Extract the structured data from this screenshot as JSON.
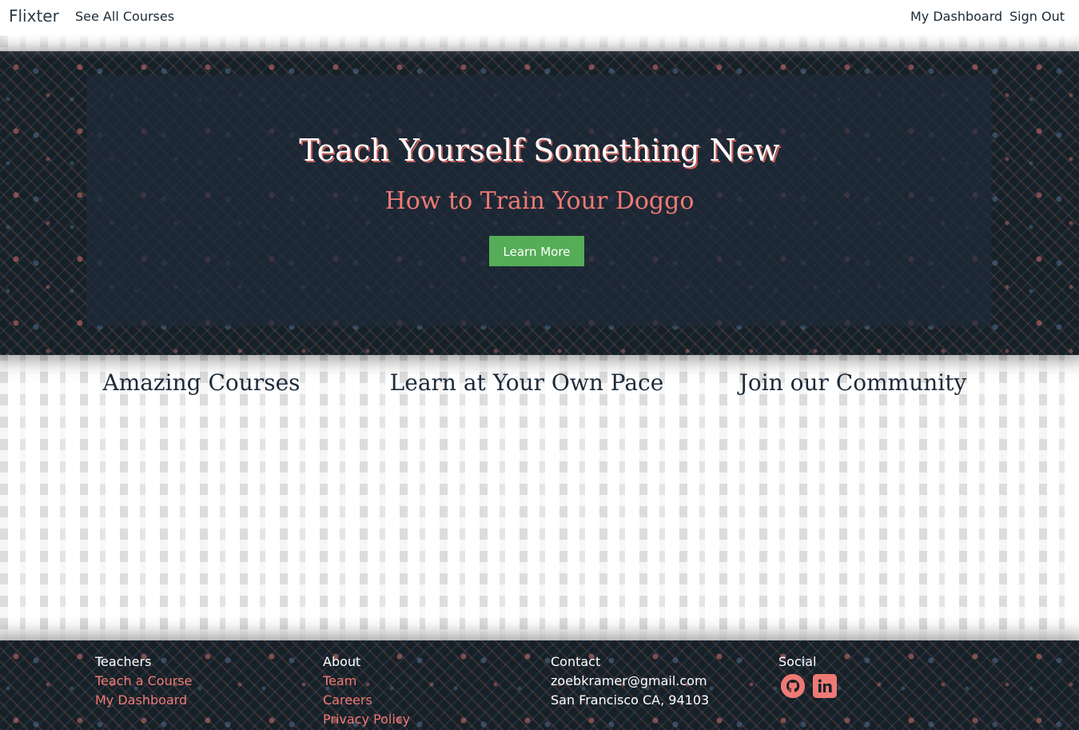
{
  "navbar": {
    "brand": "Flixter",
    "links": {
      "all_courses": "See All Courses",
      "dashboard": "My Dashboard",
      "sign_out": "Sign Out"
    }
  },
  "hero": {
    "title": "Teach Yourself Something New",
    "subtitle": "How to Train Your Doggo",
    "button": "Learn More"
  },
  "features": [
    {
      "title": "Amazing Courses",
      "text": ""
    },
    {
      "title": "Learn at Your Own Pace",
      "text": ""
    },
    {
      "title": "Join our Community",
      "text": ""
    }
  ],
  "footer": {
    "teachers": {
      "heading": "Teachers",
      "links": [
        "Teach a Course",
        "My Dashboard"
      ]
    },
    "about": {
      "heading": "About",
      "links": [
        "Team",
        "Careers",
        "Privacy Policy"
      ]
    },
    "contact": {
      "heading": "Contact",
      "email": "zoebkramer@gmail.com",
      "address": "San Francisco CA, 94103"
    },
    "social": {
      "heading": "Social",
      "icons": [
        "github-icon",
        "linkedin-icon"
      ]
    }
  },
  "colors": {
    "accent": "#ef7a75",
    "button": "#55ad57",
    "dark": "#162027"
  }
}
